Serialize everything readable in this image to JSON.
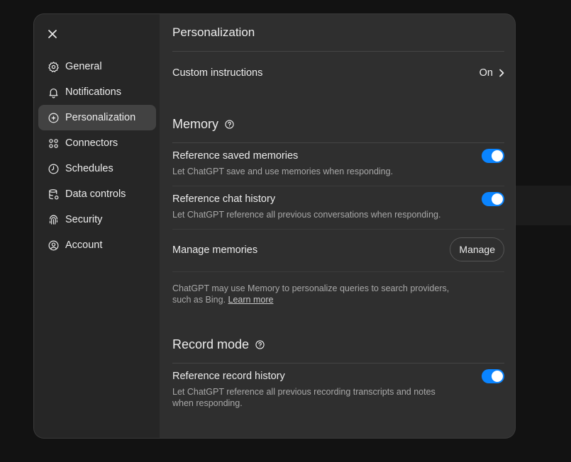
{
  "sidebar": {
    "items": [
      {
        "label": "General",
        "icon": "gear-icon"
      },
      {
        "label": "Notifications",
        "icon": "bell-icon"
      },
      {
        "label": "Personalization",
        "icon": "personalization-icon",
        "active": true
      },
      {
        "label": "Connectors",
        "icon": "connectors-icon"
      },
      {
        "label": "Schedules",
        "icon": "clock-icon"
      },
      {
        "label": "Data controls",
        "icon": "database-icon"
      },
      {
        "label": "Security",
        "icon": "fingerprint-icon"
      },
      {
        "label": "Account",
        "icon": "user-circle-icon"
      }
    ]
  },
  "main": {
    "title": "Personalization",
    "custom_instructions": {
      "label": "Custom instructions",
      "value": "On"
    },
    "memory": {
      "title": "Memory",
      "saved_memories": {
        "label": "Reference saved memories",
        "desc": "Let ChatGPT save and use memories when responding.",
        "enabled": true
      },
      "chat_history": {
        "label": "Reference chat history",
        "desc": "Let ChatGPT reference all previous conversations when responding.",
        "enabled": true
      },
      "manage": {
        "label": "Manage memories",
        "button": "Manage"
      },
      "note": {
        "line1": "ChatGPT may use Memory to personalize queries to search providers,",
        "line2": "such as Bing. ",
        "link": "Learn more"
      }
    },
    "record_mode": {
      "title": "Record mode",
      "record_history": {
        "label": "Reference record history",
        "desc_line1": "Let ChatGPT reference all previous recording transcripts and notes",
        "desc_line2": "when responding.",
        "enabled": true
      }
    }
  },
  "colors": {
    "accent": "#0a84ff",
    "dialog": "#2f2f2f",
    "sidebar": "#262626"
  }
}
